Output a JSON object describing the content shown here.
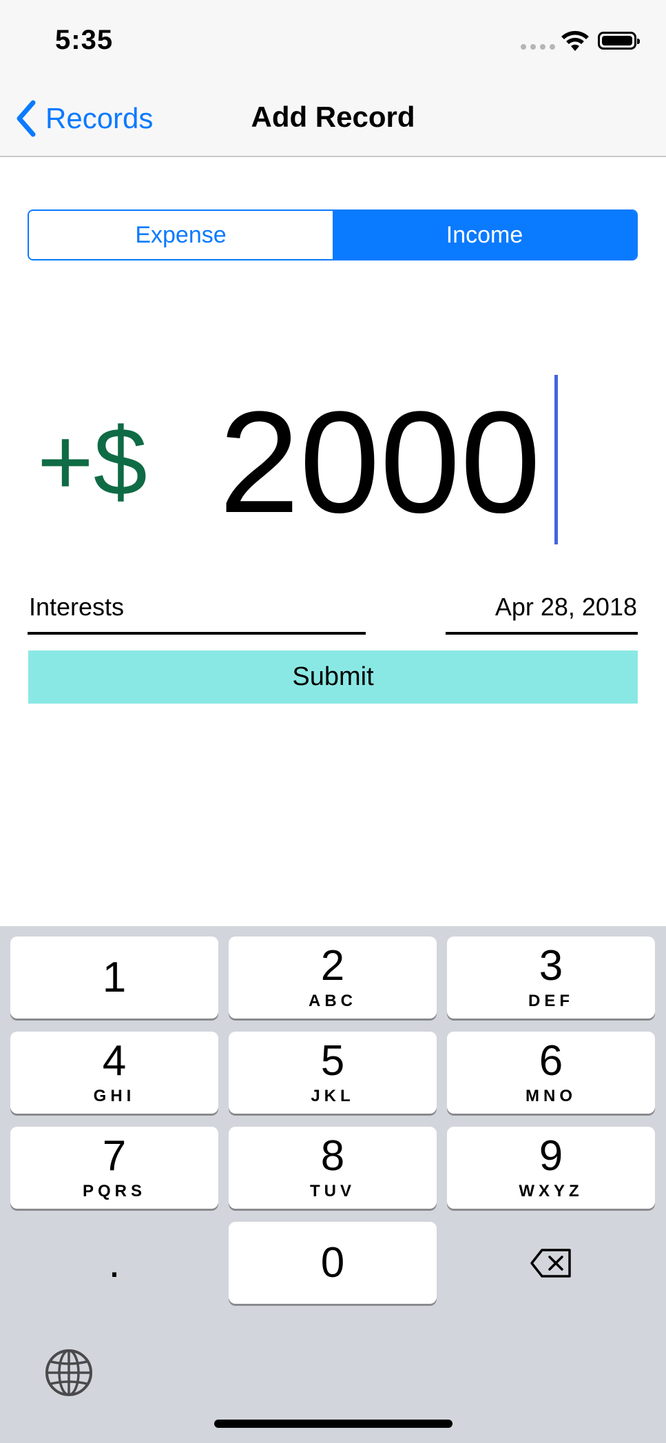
{
  "status": {
    "time": "5:35"
  },
  "nav": {
    "back_label": "Records",
    "title": "Add Record"
  },
  "segmented": {
    "options": [
      "Expense",
      "Income"
    ],
    "selected": "Income"
  },
  "amount": {
    "sign": "+$",
    "value": "2000"
  },
  "form": {
    "category": "Interests",
    "date": "Apr 28, 2018",
    "submit_label": "Submit"
  },
  "keypad": {
    "keys": [
      {
        "num": "1",
        "letters": ""
      },
      {
        "num": "2",
        "letters": "ABC"
      },
      {
        "num": "3",
        "letters": "DEF"
      },
      {
        "num": "4",
        "letters": "GHI"
      },
      {
        "num": "5",
        "letters": "JKL"
      },
      {
        "num": "6",
        "letters": "MNO"
      },
      {
        "num": "7",
        "letters": "PQRS"
      },
      {
        "num": "8",
        "letters": "TUV"
      },
      {
        "num": "9",
        "letters": "WXYZ"
      },
      {
        "num": ".",
        "letters": ""
      },
      {
        "num": "0",
        "letters": ""
      }
    ]
  },
  "colors": {
    "accent": "#0a7aff",
    "income_green": "#0f6b45",
    "submit_bg": "#8ae8e4",
    "keyboard_bg": "#d2d5db"
  },
  "icons": [
    "chevron-left-icon",
    "wifi-icon",
    "battery-icon",
    "delete-icon",
    "globe-icon"
  ]
}
